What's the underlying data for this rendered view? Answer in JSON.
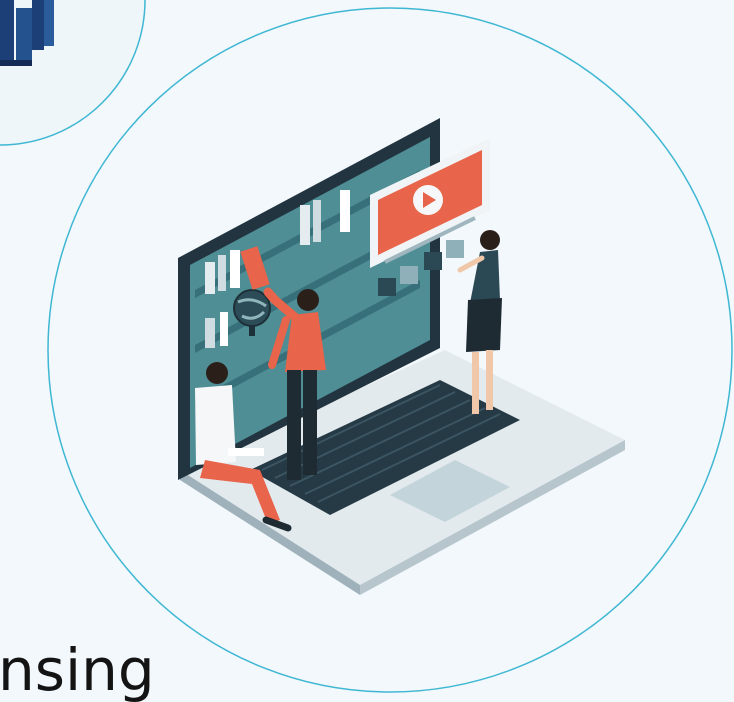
{
  "caption": {
    "text": "nsing"
  },
  "colors": {
    "background": "#f2f8fb",
    "circle_stroke": "#3fb7d3",
    "accent_orange": "#e8644a",
    "laptop_dark": "#273a44",
    "laptop_silver": "#d2dde2",
    "screen_teal": "#4f8e95",
    "book_navy": "#1d3f77"
  },
  "icons": [
    "book-stack-icon",
    "play-icon",
    "globe-icon"
  ]
}
